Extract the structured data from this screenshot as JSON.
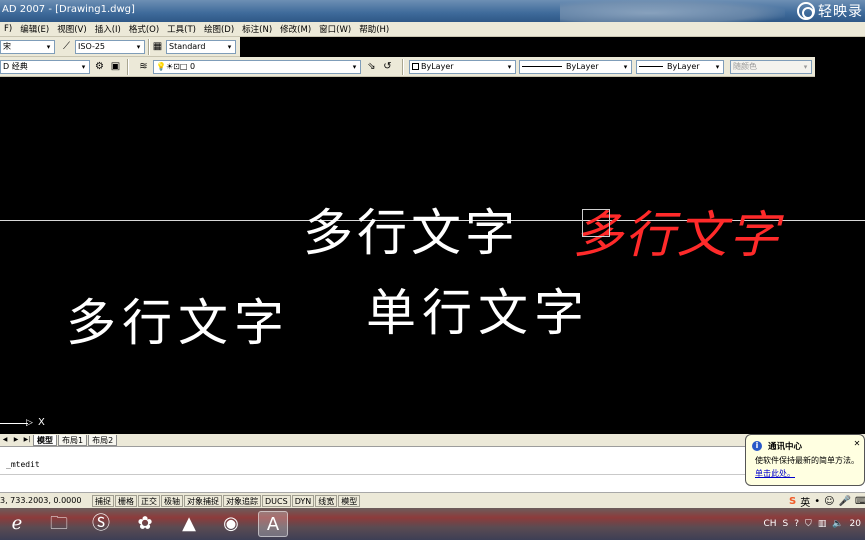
{
  "window": {
    "title": "AD 2007 - [Drawing1.dwg]"
  },
  "watermark": {
    "text": "轻映录"
  },
  "menu": [
    "F)",
    "编辑(E)",
    "视图(V)",
    "插入(I)",
    "格式(O)",
    "工具(T)",
    "绘图(D)",
    "标注(N)",
    "修改(M)",
    "窗口(W)",
    "帮助(H)"
  ],
  "toolbar1": {
    "text_style": "宋",
    "dim_style": "ISO-25",
    "table_style": "Standard"
  },
  "toolbar2": {
    "workspace": "D 经典",
    "layer": "0",
    "color": "ByLayer",
    "linetype": "ByLayer",
    "lineweight": "ByLayer",
    "plot_style": "随颜色"
  },
  "drawing": {
    "texts": [
      {
        "id": "t1",
        "value": "多行文字",
        "color": "#ffffff"
      },
      {
        "id": "t2",
        "value": "多行文字",
        "color": "#ff2a2a"
      },
      {
        "id": "t3",
        "value": "多行文字",
        "color": "#ffffff"
      },
      {
        "id": "t4",
        "value": "单行文字",
        "color": "#ffffff"
      }
    ],
    "ucs_label": "X"
  },
  "tabs": {
    "model": "模型",
    "layout1": "布局1",
    "layout2": "布局2"
  },
  "command": {
    "line1": "_mtedit"
  },
  "status": {
    "coords": "3, 733.2003, 0.0000",
    "buttons": [
      "捕捉",
      "栅格",
      "正交",
      "极轴",
      "对象捕捉",
      "对象追踪",
      "DUCS",
      "DYN",
      "线宽",
      "模型"
    ]
  },
  "balloon": {
    "title": "通讯中心",
    "body": "使软件保持最新的简单方法。",
    "link": "单击此处。"
  },
  "ime": {
    "lang": "英"
  },
  "systray": {
    "label": "CH",
    "clock": "20"
  }
}
